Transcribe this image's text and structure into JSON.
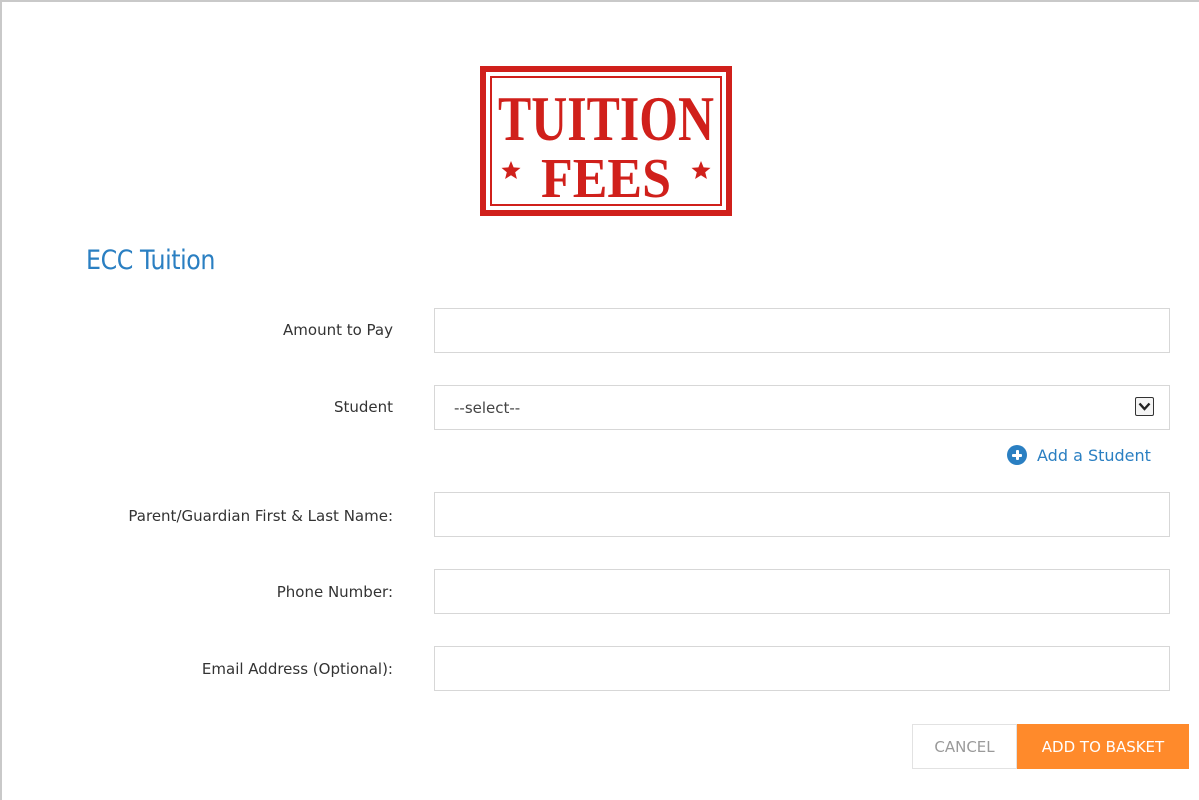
{
  "logo": {
    "line1": "TUITION",
    "line2": "FEES",
    "color": "#d0201b"
  },
  "form": {
    "title": "ECC Tuition",
    "fields": [
      {
        "label": "Amount to Pay",
        "value": "",
        "placeholder": ""
      },
      {
        "label": "Student",
        "selected": "--select--"
      },
      {
        "label": "Parent/Guardian First & Last Name:",
        "value": "",
        "placeholder": ""
      },
      {
        "label": "Phone Number:",
        "value": "",
        "placeholder": ""
      },
      {
        "label": "Email Address (Optional):",
        "value": "",
        "placeholder": ""
      }
    ],
    "add_student_label": "Add a Student",
    "cancel_label": "CANCEL",
    "add_to_basket_label": "ADD TO BASKET"
  },
  "colors": {
    "accent_blue": "#2a7fc2",
    "button_orange": "#ff8a2b",
    "stamp_red": "#d0201b"
  },
  "icons": {
    "add_student": "plus-circle-icon",
    "select_arrow": "chevron-down-icon"
  }
}
